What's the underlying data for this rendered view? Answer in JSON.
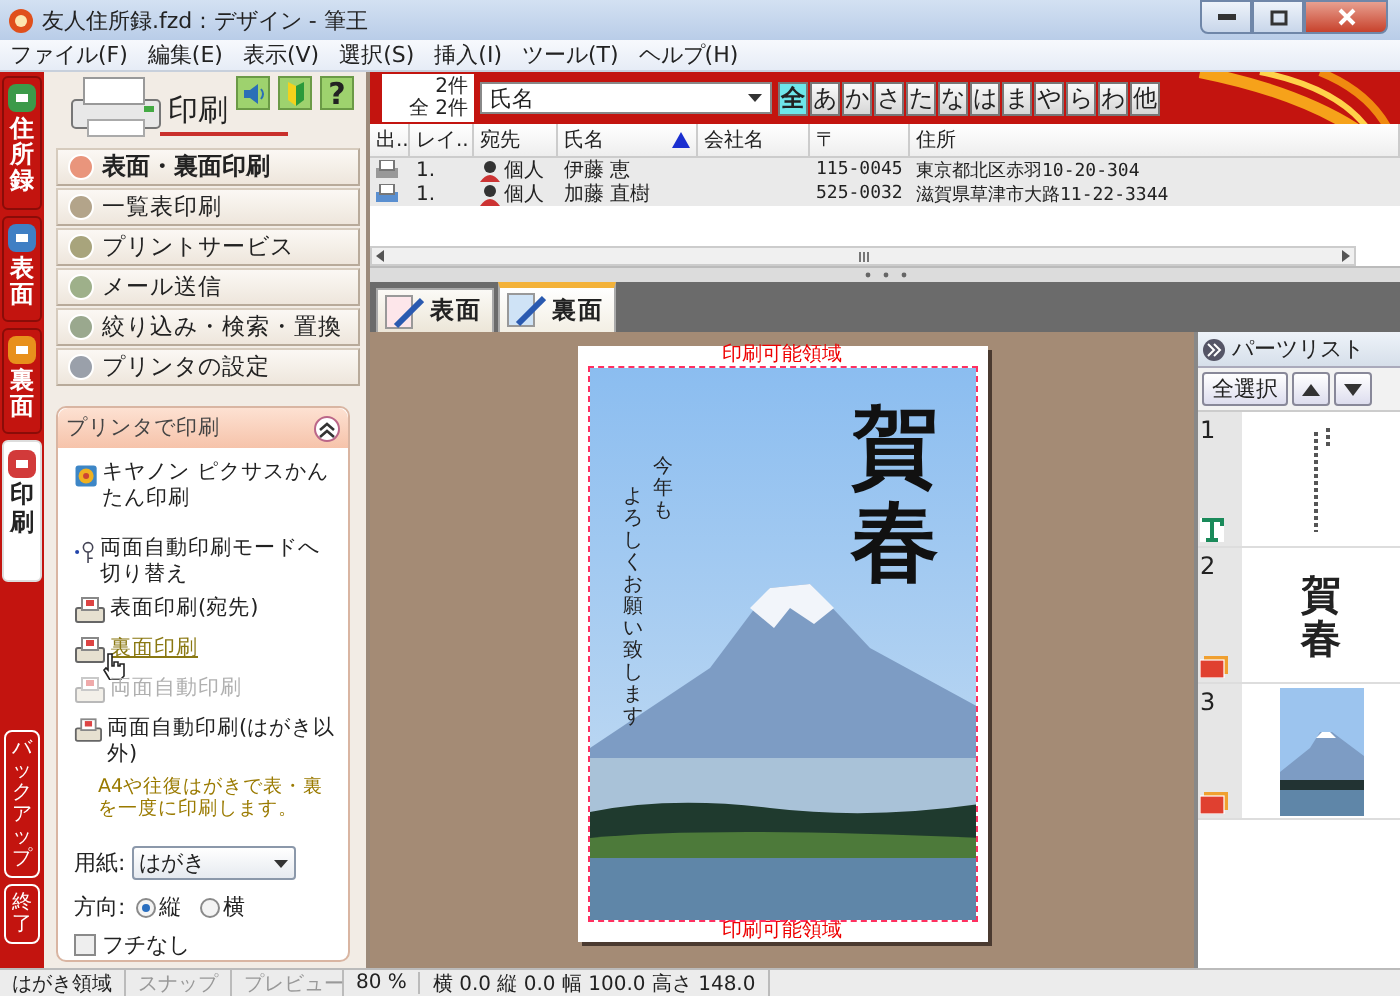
{
  "window": {
    "title": "友人住所録.fzd : デザイン - 筆王"
  },
  "menu": [
    "ファイル(F)",
    "編集(E)",
    "表示(V)",
    "選択(S)",
    "挿入(I)",
    "ツール(T)",
    "ヘルプ(H)"
  ],
  "side_tabs": [
    {
      "label": "住所録",
      "selected": false,
      "color": "#3c9a4a"
    },
    {
      "label": "表面",
      "selected": false,
      "color": "#3f7fc4"
    },
    {
      "label": "裏面",
      "selected": false,
      "color": "#e8901c"
    },
    {
      "label": "印刷",
      "selected": true,
      "color": "#d23a3a"
    }
  ],
  "side_buttons": [
    "バックアップ",
    "終了"
  ],
  "print_panel": {
    "title": "印刷",
    "help": "?",
    "commands": [
      {
        "label": "表面・裏面印刷",
        "selected": true,
        "color": "#e9957c"
      },
      {
        "label": "一覧表印刷",
        "selected": false,
        "color": "#b3a48a"
      },
      {
        "label": "プリントサービス",
        "selected": false,
        "color": "#a8a47c"
      },
      {
        "label": "メール送信",
        "selected": false,
        "color": "#9eb08a"
      },
      {
        "label": "絞り込み・検索・置換",
        "selected": false,
        "color": "#9aa88e"
      },
      {
        "label": "プリンタの設定",
        "selected": false,
        "color": "#9aa0aa"
      }
    ],
    "task_box": {
      "title": "プリンタで印刷",
      "expanded": true,
      "items": [
        {
          "kind": "printer",
          "label": "キヤノン ピクサスかんたん印刷",
          "disabled": false,
          "highlighted": false
        },
        {
          "kind": "mode",
          "label": "両面自動印刷モードへ切り替え",
          "disabled": false,
          "highlighted": false
        },
        {
          "kind": "print",
          "label": "表面印刷(宛先)",
          "disabled": false,
          "highlighted": false
        },
        {
          "kind": "print",
          "label": "裏面印刷",
          "disabled": false,
          "highlighted": true
        },
        {
          "kind": "print",
          "label": "両面自動印刷",
          "disabled": true,
          "highlighted": false
        },
        {
          "kind": "print",
          "label": "両面自動印刷(はがき以外)",
          "disabled": false,
          "highlighted": false
        }
      ],
      "note": "A4や往復はがきで表・裏を一度に印刷します。",
      "paper": {
        "label": "用紙:",
        "value": "はがき"
      },
      "orientation": {
        "label": "方向:",
        "options": [
          {
            "label": "縦",
            "selected": true
          },
          {
            "label": "横",
            "selected": false
          }
        ]
      },
      "borderless": {
        "label": "フチなし",
        "checked": false
      }
    }
  },
  "address_list": {
    "count": "2件",
    "total": "全 2件",
    "sort_field": "氏名",
    "kana": [
      {
        "label": "全",
        "selected": true
      },
      {
        "label": "あ",
        "selected": false
      },
      {
        "label": "か",
        "selected": false
      },
      {
        "label": "さ",
        "selected": false
      },
      {
        "label": "た",
        "selected": false
      },
      {
        "label": "な",
        "selected": false
      },
      {
        "label": "は",
        "selected": false
      },
      {
        "label": "ま",
        "selected": false
      },
      {
        "label": "や",
        "selected": false
      },
      {
        "label": "ら",
        "selected": false
      },
      {
        "label": "わ",
        "selected": false
      },
      {
        "label": "他",
        "selected": false
      }
    ],
    "columns": [
      "出..",
      "レイ..",
      "宛先",
      "氏名",
      "会社名",
      "〒",
      "住所"
    ],
    "rows": [
      {
        "layout": "1.",
        "recipient": "個人",
        "name": "伊藤 恵",
        "zip": "115-0045",
        "address": "東京都北区赤羽10-20-304"
      },
      {
        "layout": "1.",
        "recipient": "個人",
        "name": "加藤 直樹",
        "zip": "525-0032",
        "address": "滋賀県草津市大路11-22-3344"
      }
    ]
  },
  "design": {
    "tabs": [
      {
        "label": "表面",
        "selected": false
      },
      {
        "label": "裏面",
        "selected": true
      }
    ],
    "card": {
      "area_label_top": "印刷可能領域",
      "greeting": "賀春",
      "message": [
        "今年も",
        "よろしくお願い致します"
      ],
      "area_label_bottom": "印刷可能領域"
    }
  },
  "parts_list": {
    "title": "パーツリスト",
    "select_all": "全選択",
    "items": [
      {
        "number": "1",
        "kind": "text"
      },
      {
        "number": "2",
        "kind": "greeting",
        "preview": "賀春"
      },
      {
        "number": "3",
        "kind": "photo"
      }
    ]
  },
  "status_bar": [
    {
      "text": "はがき領域",
      "disabled": false
    },
    {
      "text": "スナップ",
      "disabled": true
    },
    {
      "text": "プレビュー",
      "disabled": true
    },
    {
      "text": "80 %",
      "disabled": false
    },
    {
      "text": "横 0.0 縦 0.0 幅 100.0 高さ 148.0",
      "disabled": false
    }
  ]
}
